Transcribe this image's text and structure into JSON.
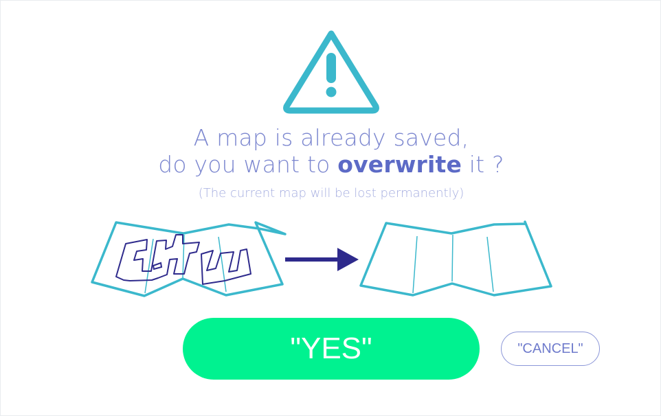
{
  "dialog": {
    "title_line1": "A map is already saved,",
    "title_line2_prefix": "do you want to ",
    "title_line2_emphasis": "overwrite",
    "title_line2_suffix": " it ?",
    "subtitle": "(The current map will be lost permanently)"
  },
  "icons": {
    "warning": "warning-triangle-icon",
    "map_with_path": "map-with-path-icon",
    "arrow": "arrow-right-icon",
    "map_empty": "empty-map-icon"
  },
  "buttons": {
    "yes_label": "\"YES\"",
    "cancel_label": "\"CANCEL\""
  },
  "colors": {
    "accent_teal": "#3bb8cc",
    "title_blue": "#7b86cf",
    "arrow_navy": "#2e2a8c",
    "yes_green": "#00f290",
    "cancel_border": "#8b96d8"
  }
}
